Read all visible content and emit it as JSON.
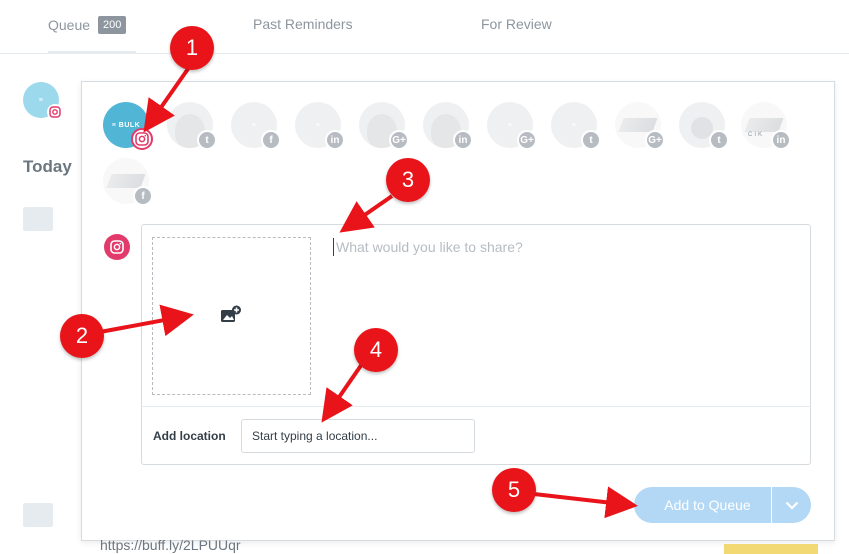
{
  "tabs": [
    {
      "label": "Queue",
      "count": "200"
    },
    {
      "label": "Past Reminders"
    },
    {
      "label": "For Review"
    }
  ],
  "sidebar": {
    "day_heading": "Today"
  },
  "profiles": [
    {
      "name": "business-logo",
      "network": "instagram",
      "selected": true
    },
    {
      "name": "person",
      "network": "twitter"
    },
    {
      "name": "business-logo",
      "network": "facebook"
    },
    {
      "name": "business-logo",
      "network": "linkedin"
    },
    {
      "name": "person",
      "network": "google-plus"
    },
    {
      "name": "person",
      "network": "linkedin"
    },
    {
      "name": "business-logo",
      "network": "google-plus"
    },
    {
      "name": "business-logo",
      "network": "twitter"
    },
    {
      "name": "building",
      "network": "google-plus"
    },
    {
      "name": "silhouette",
      "network": "twitter"
    },
    {
      "name": "building",
      "network": "linkedin",
      "text": "CIK"
    },
    {
      "name": "building",
      "network": "facebook"
    }
  ],
  "network_glyphs": {
    "twitter": "t",
    "facebook": "f",
    "linkedin": "in",
    "google-plus": "G+"
  },
  "composer": {
    "placeholder": "What would you like to share?",
    "location_label": "Add location",
    "location_placeholder": "Start typing a location...",
    "submit_label": "Add to Queue"
  },
  "footer": {
    "link_text": "https://buff.ly/2LPUUqr"
  },
  "annotations": [
    "1",
    "2",
    "3",
    "4",
    "5"
  ],
  "colors": {
    "annotation": "#e8141a",
    "instagram": "#e23a6a",
    "button": "#b3d8f6"
  }
}
